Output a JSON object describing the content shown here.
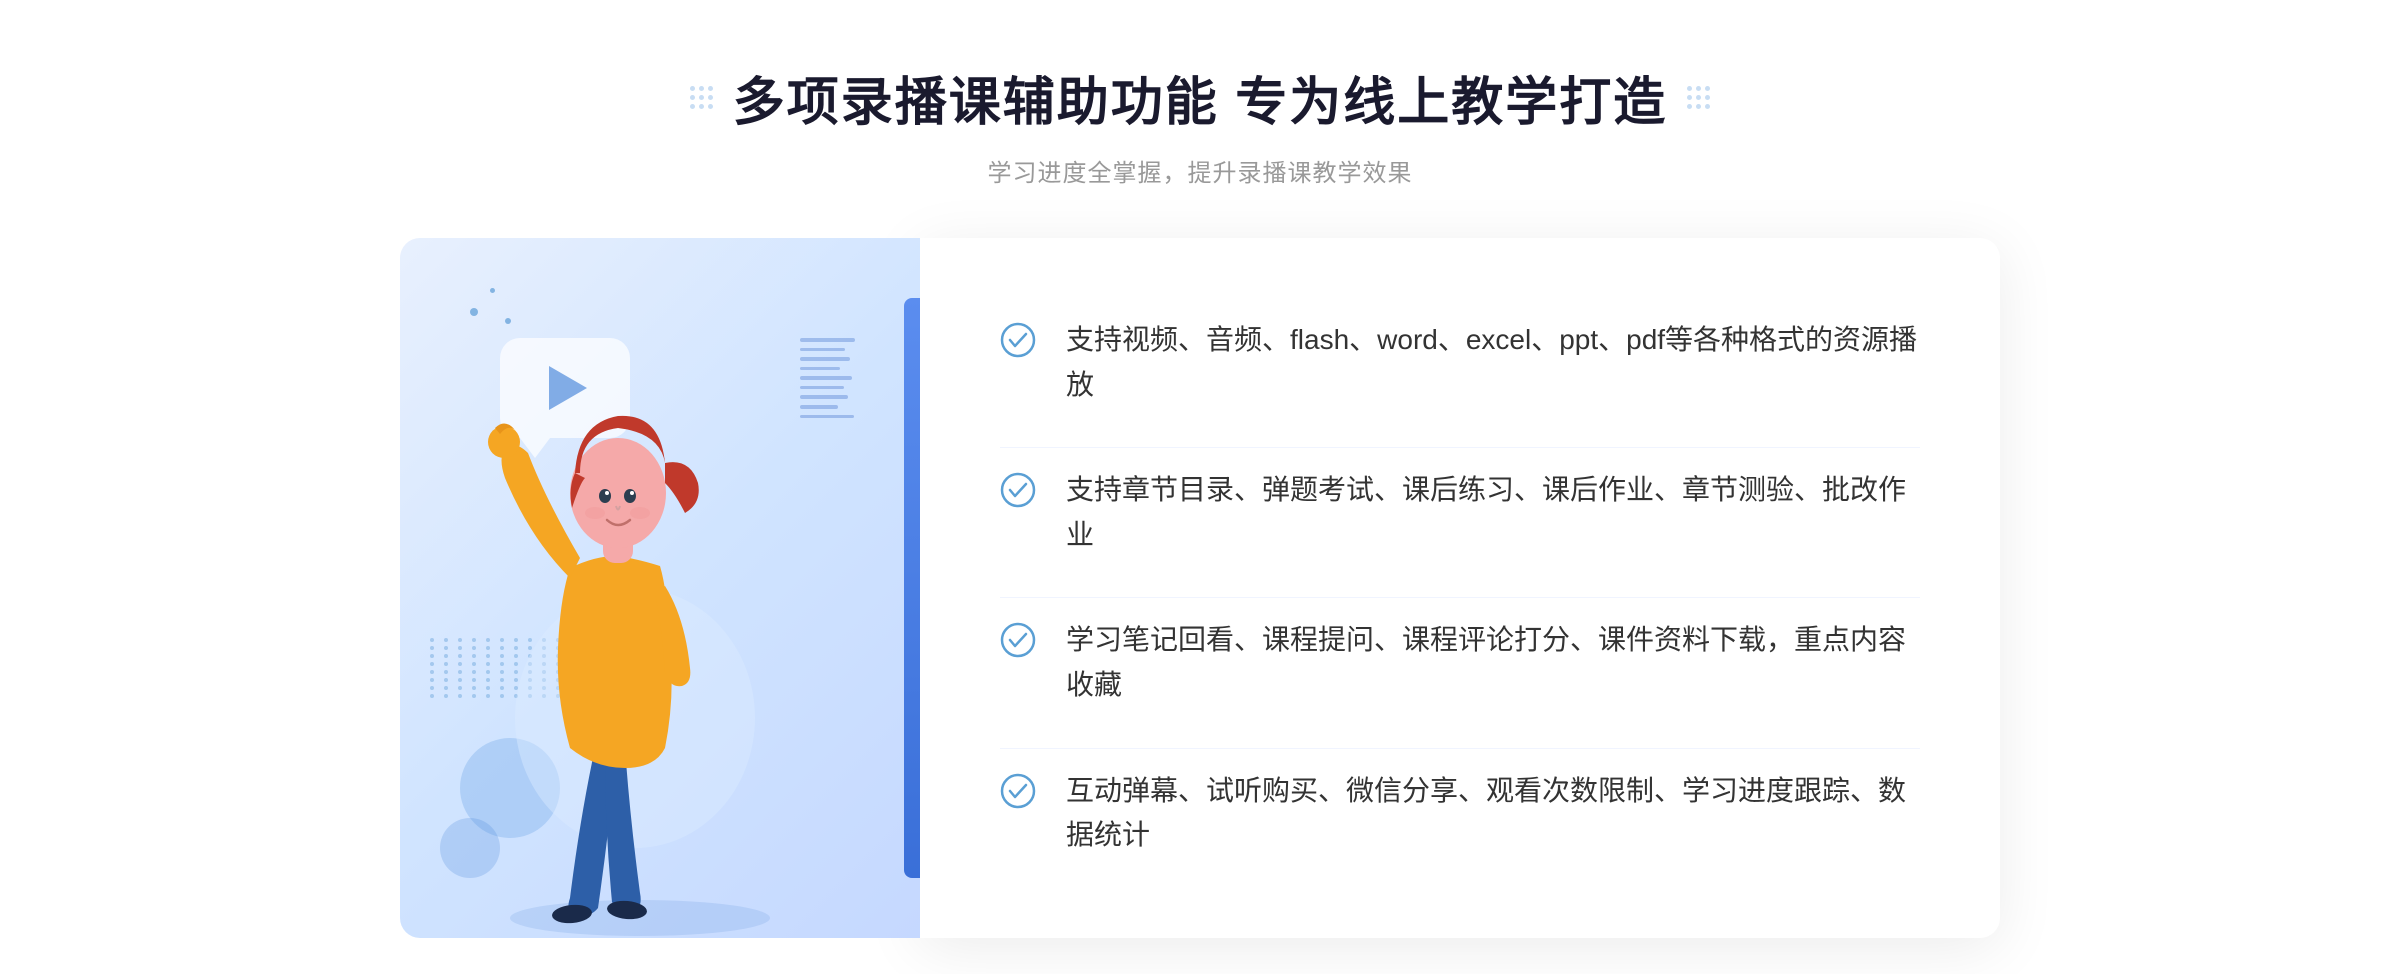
{
  "header": {
    "title": "多项录播课辅助功能 专为线上教学打造",
    "subtitle": "学习进度全掌握，提升录播课教学效果"
  },
  "features": [
    {
      "id": "feature-1",
      "text": "支持视频、音频、flash、word、excel、ppt、pdf等各种格式的资源播放"
    },
    {
      "id": "feature-2",
      "text": "支持章节目录、弹题考试、课后练习、课后作业、章节测验、批改作业"
    },
    {
      "id": "feature-3",
      "text": "学习笔记回看、课程提问、课程评论打分、课件资料下载，重点内容收藏"
    },
    {
      "id": "feature-4",
      "text": "互动弹幕、试听购买、微信分享、观看次数限制、学习进度跟踪、数据统计"
    }
  ],
  "decorative": {
    "left_arrow": "«",
    "accent_color": "#4080d0",
    "check_color": "#5a9fd4"
  }
}
